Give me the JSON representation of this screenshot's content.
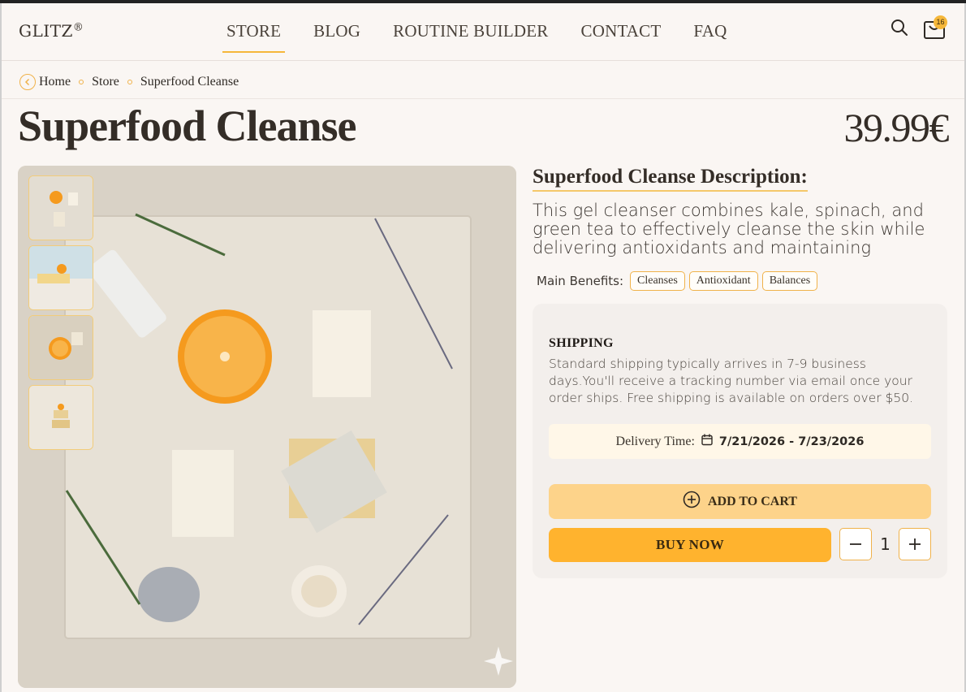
{
  "header": {
    "logo": "GLITZ",
    "logo_mark": "®",
    "nav": [
      "STORE",
      "BLOG",
      "ROUTINE BUILDER",
      "CONTACT",
      "FAQ"
    ],
    "active_nav": "STORE",
    "cart_count": "16",
    "search_icon": "search-icon",
    "cart_icon": "shopping-bag-icon"
  },
  "breadcrumb": {
    "items": [
      "Home",
      "Store",
      "Superfood Cleanse"
    ]
  },
  "product": {
    "title": "Superfood Cleanse",
    "price": "39.99€",
    "description_title": "Superfood Cleanse Description:",
    "description": "This gel cleanser combines kale, spinach, and green tea to effectively cleanse the skin while delivering antioxidants and maintaining moisture levels.",
    "benefits_label": "Main Benefits:",
    "benefits": [
      "Cleanses",
      "Antioxidant",
      "Balances"
    ],
    "thumbnails": 4
  },
  "shipping": {
    "heading": "SHIPPING",
    "text": "Standard shipping typically arrives in 7-9 business days.You'll receive a tracking number via email once your order ships. Free shipping is available on orders over $50.",
    "delivery_label": "Delivery Time:",
    "delivery_dates": "7/21/2026 - 7/23/2026"
  },
  "actions": {
    "add_to_cart": "ADD TO CART",
    "buy_now": "BUY NOW",
    "quantity": "1"
  },
  "colors": {
    "accent": "#f5b73a",
    "buy_now": "#ffb32e",
    "add_to_cart": "#fdd38a",
    "background": "#faf6f3"
  }
}
